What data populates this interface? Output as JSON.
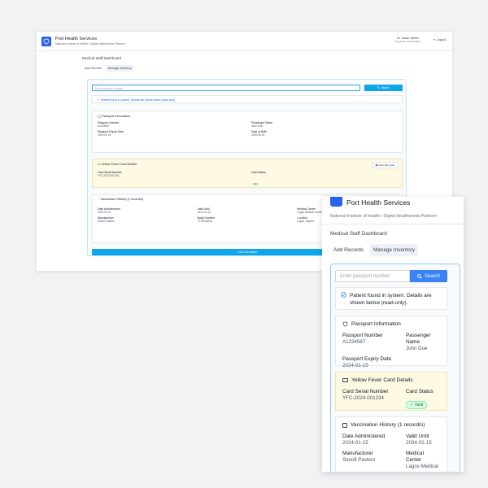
{
  "app": {
    "title": "Port Health Services",
    "subtitle": "National Institute of Health • Digital Healthwords Platform"
  },
  "user": {
    "name": "Dr. Sarah Wilson",
    "role": "Physician/ Health Officer",
    "logout_label": "Logout"
  },
  "dashboard_title": "Medical Staff Dashboard",
  "tabs": [
    {
      "label": "Add Records"
    },
    {
      "label": "Manage Inventory"
    }
  ],
  "search": {
    "placeholder": "Enter passport number",
    "button_label": "Search"
  },
  "found_message": "Patient found in system. Details are shown below (read-only).",
  "passport": {
    "heading": "Passport Information",
    "number_label": "Passport Number",
    "number": "A1234567",
    "passenger_label": "Passenger Name",
    "passenger": "John Doe",
    "expiry_label": "Passport Expiry Date",
    "expiry": "2024-01-15",
    "dob_label": "Date of Birth",
    "dob": "2000-05-15"
  },
  "yellow_card": {
    "heading": "Yellow Fever Card Details",
    "qr_label": "View QR Code",
    "serial_label": "Card Serial Number",
    "serial": "YFC-2024-001234",
    "status_label": "Card Status",
    "status": "Valid"
  },
  "vaccination": {
    "heading": "Vaccination History (1 record/s)",
    "date_label": "Date Administered",
    "date": "2024-01-15",
    "valid_label": "Valid Until",
    "valid": "2034-01-15",
    "center_label": "Medical Center",
    "center": "Lagos Medical Center",
    "manufacturer_label": "Manufacturer",
    "manufacturer": "Sanofi Pasteur",
    "batch_label": "Batch Number",
    "batch": "YF2024A001",
    "location_label": "Location",
    "location": "Lagos, Nigeria"
  },
  "add_vaccination_label": "+ Add Vaccination",
  "mobile": {
    "subtitle": "National Institute of Health • Digital Healthwords Platform",
    "found_message": "Patient found in system. Details are shown below (read-only).",
    "passenger_label": "Passenger Name",
    "vaccination_heading": "Vaccination History (1 record/s)",
    "center_short": "Lagos Medical"
  },
  "colors": {
    "accent": "#0ea5e9",
    "brand": "#2563eb",
    "yellow_bg": "#fdf9e3",
    "valid_green": "#15803d"
  }
}
